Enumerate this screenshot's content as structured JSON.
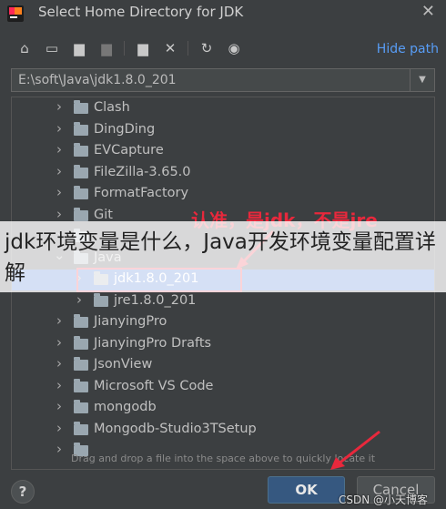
{
  "window": {
    "title": "Select Home Directory for JDK"
  },
  "toolbar": {
    "icons": [
      "home-icon",
      "desktop-icon",
      "project-folder-icon",
      "module-folder-icon",
      "new-folder-icon",
      "delete-icon",
      "refresh-icon",
      "show-hidden-icon"
    ],
    "hide_path_label": "Hide path"
  },
  "path": {
    "value": "E:\\soft\\Java\\jdk1.8.0_201"
  },
  "tree": {
    "items": [
      {
        "label": "Clash",
        "level": 0,
        "expanded": false
      },
      {
        "label": "DingDing",
        "level": 0,
        "expanded": false
      },
      {
        "label": "EVCapture",
        "level": 0,
        "expanded": false
      },
      {
        "label": "FileZilla-3.65.0",
        "level": 0,
        "expanded": false
      },
      {
        "label": "FormatFactory",
        "level": 0,
        "expanded": false
      },
      {
        "label": "Git",
        "level": 0,
        "expanded": false
      },
      {
        "label": "",
        "level": 0,
        "expanded": false
      },
      {
        "label": "Java",
        "level": 0,
        "expanded": true
      },
      {
        "label": "jdk1.8.0_201",
        "level": 1,
        "expanded": false,
        "selected": true
      },
      {
        "label": "jre1.8.0_201",
        "level": 1,
        "expanded": false
      },
      {
        "label": "JianyingPro",
        "level": 0,
        "expanded": false
      },
      {
        "label": "JianyingPro Drafts",
        "level": 0,
        "expanded": false
      },
      {
        "label": "JsonView",
        "level": 0,
        "expanded": false
      },
      {
        "label": "Microsoft VS Code",
        "level": 0,
        "expanded": false
      },
      {
        "label": "mongodb",
        "level": 0,
        "expanded": false
      },
      {
        "label": "Mongodb-Studio3TSetup",
        "level": 0,
        "expanded": false
      },
      {
        "label": "",
        "level": 0,
        "expanded": false
      }
    ]
  },
  "annotation": {
    "text": "认准，是jdk，不是jre"
  },
  "banner": {
    "text": "jdk环境变量是什么，Java开发环境变量配置详解"
  },
  "hint": {
    "text": "Drag and drop a file into the space above to quickly locate it"
  },
  "buttons": {
    "help": "?",
    "ok": "OK",
    "cancel": "Cancel"
  },
  "watermark": {
    "text": "CSDN @小天博客"
  },
  "colors": {
    "selection": "#2f65ca",
    "link": "#589df6",
    "annotation": "#e8283c",
    "ok_button": "#365880"
  }
}
